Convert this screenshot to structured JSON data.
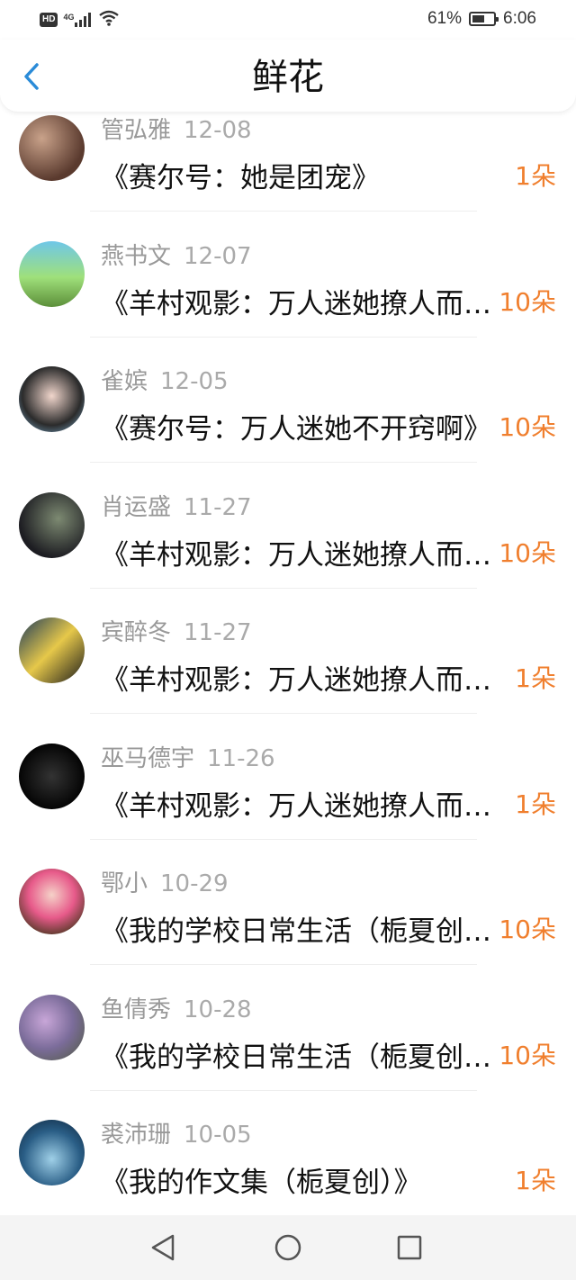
{
  "status_bar": {
    "hd": "HD",
    "network": "4G",
    "battery_percent": "61%",
    "battery_level": 0.61,
    "time": "6:06"
  },
  "header": {
    "title": "鲜花"
  },
  "items": [
    {
      "name": "管弘雅",
      "date": "12-08",
      "book": "《赛尔号：她是团宠》",
      "count": "1朵"
    },
    {
      "name": "燕书文",
      "date": "12-07",
      "book": "《羊村观影：万人迷她撩人而不自知》",
      "count": "10朵"
    },
    {
      "name": "雀嫔",
      "date": "12-05",
      "book": "《赛尔号：万人迷她不开窍啊》",
      "count": "10朵"
    },
    {
      "name": "肖运盛",
      "date": "11-27",
      "book": "《羊村观影：万人迷她撩人而不自知》",
      "count": "10朵"
    },
    {
      "name": "宾醉冬",
      "date": "11-27",
      "book": "《羊村观影：万人迷她撩人而不自知》",
      "count": "1朵"
    },
    {
      "name": "巫马德宇",
      "date": "11-26",
      "book": "《羊村观影：万人迷她撩人而不自知》",
      "count": "1朵"
    },
    {
      "name": "鄂小",
      "date": "10-29",
      "book": "《我的学校日常生活（栀夏创）》",
      "count": "10朵"
    },
    {
      "name": "鱼倩秀",
      "date": "10-28",
      "book": "《我的学校日常生活（栀夏创）》",
      "count": "10朵"
    },
    {
      "name": "裘沛珊",
      "date": "10-05",
      "book": "《我的作文集（栀夏创）》",
      "count": "1朵"
    }
  ],
  "colors": {
    "accent": "#2a8bd8",
    "count": "#f07f2e",
    "name": "#999999"
  },
  "icons": {
    "back": "chevron-left-icon",
    "nav_back": "triangle-back-icon",
    "nav_home": "circle-home-icon",
    "nav_recents": "square-recents-icon"
  }
}
